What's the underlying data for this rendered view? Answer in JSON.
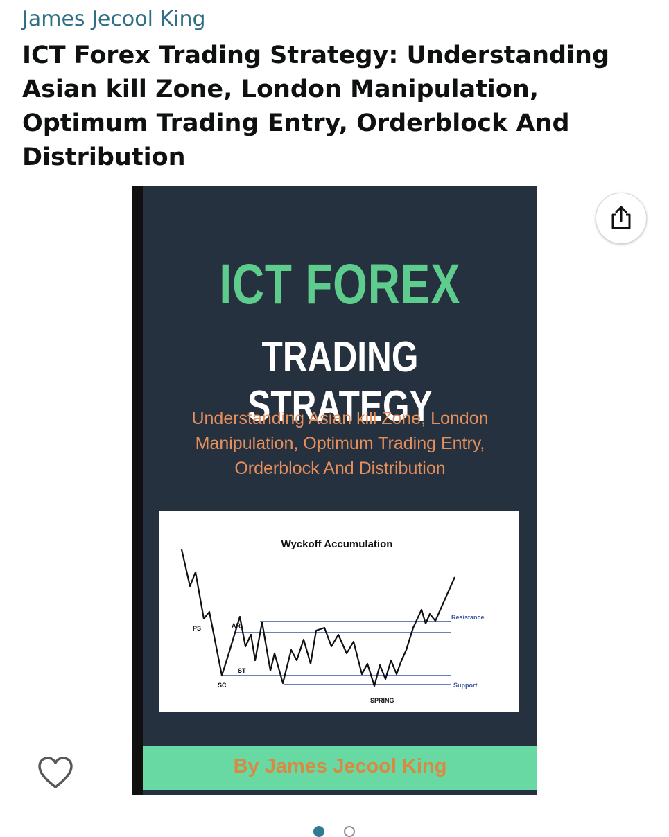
{
  "product": {
    "author_link": "James Jecool King",
    "title": "ICT Forex Trading Strategy: Understanding Asian kill Zone, London Manipulation, Optimum Trading Entry, Orderblock And Distribution"
  },
  "cover": {
    "headline": "ICT FOREX",
    "subheadline": "TRADING STRATEGY",
    "subtitle_lines": [
      "Understanding Asian kill Zone, London",
      "Manipulation, Optimum Trading Entry,",
      "Orderblock And  Distribution"
    ],
    "byline": "By James Jecool King",
    "colors": {
      "background": "#26313f",
      "headline": "#5dcc8d",
      "subtitle": "#e58f5d",
      "band": "#69d9a4",
      "byline": "#d98a42"
    },
    "diagram": {
      "title": "Wyckoff Accumulation",
      "labels": {
        "ps": "PS",
        "ar": "AR",
        "st": "ST",
        "sc": "SC",
        "spring": "SPRING",
        "resistance": "Resistance",
        "support": "Support"
      }
    }
  },
  "icons": {
    "share": "share-icon",
    "favorite": "heart-icon"
  },
  "carousel": {
    "count": 2,
    "active_index": 0
  }
}
